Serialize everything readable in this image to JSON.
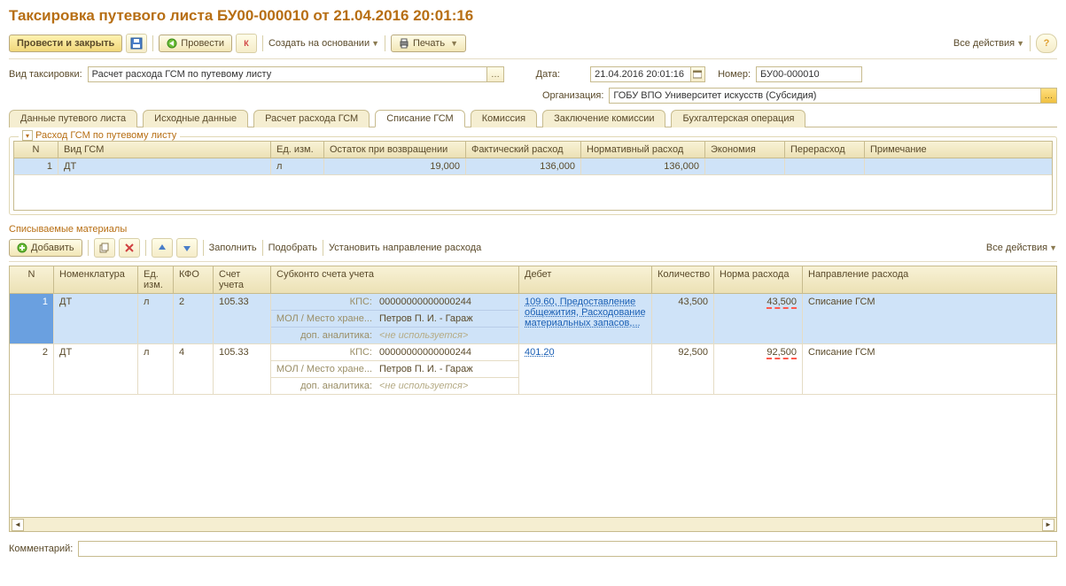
{
  "header": {
    "title": "Таксировка путевого листа БУ00-000010 от 21.04.2016 20:01:16"
  },
  "toolbar": {
    "post_close": "Провести и закрыть",
    "post": "Провести",
    "create_based": "Создать на основании",
    "print": "Печать",
    "all_actions": "Все действия"
  },
  "form": {
    "type_label": "Вид таксировки:",
    "type_value": "Расчет расхода ГСМ по путевому листу",
    "date_label": "Дата:",
    "date_value": "21.04.2016 20:01:16",
    "number_label": "Номер:",
    "number_value": "БУ00-000010",
    "org_label": "Организация:",
    "org_value": "ГОБУ ВПО Университет искусств (Субсидия)"
  },
  "tabs": [
    "Данные путевого листа",
    "Исходные данные",
    "Расчет расхода ГСМ",
    "Списание ГСМ",
    "Комиссия",
    "Заключение комиссии",
    "Бухгалтерская операция"
  ],
  "active_tab": 3,
  "fuel_group": {
    "legend": "Расход ГСМ по путевому листу",
    "headers": [
      "N",
      "Вид ГСМ",
      "Ед. изм.",
      "Остаток при возвращении",
      "Фактический расход",
      "Нормативный расход",
      "Экономия",
      "Перерасход",
      "Примечание"
    ],
    "widths": [
      50,
      240,
      60,
      160,
      130,
      140,
      90,
      90,
      200
    ],
    "rows": [
      {
        "n": "1",
        "kind": "ДТ",
        "unit": "л",
        "remain": "19,000",
        "fact": "136,000",
        "norm": "136,000",
        "econ": "",
        "over": "",
        "note": ""
      }
    ]
  },
  "materials": {
    "title": "Списываемые материалы",
    "add": "Добавить",
    "fill": "Заполнить",
    "pick": "Подобрать",
    "set_dir": "Установить направление расхода",
    "all_actions": "Все действия",
    "headers": [
      "N",
      "Номенклатура",
      "Ед. изм.",
      "КФО",
      "Счет учета",
      "Субконто счета учета",
      "Дебет",
      "Количество",
      "Норма расхода",
      "Направление расхода"
    ],
    "widths": [
      50,
      95,
      40,
      45,
      65,
      280,
      150,
      70,
      100,
      245
    ],
    "sub_labels": {
      "kps": "КПС:",
      "mol": "МОЛ / Место хране...",
      "add": "доп. аналитика:",
      "not_used": "<не используется>"
    },
    "rows": [
      {
        "n": "1",
        "nom": "ДТ",
        "unit": "л",
        "kfo": "2",
        "acc": "105.33",
        "kps": "00000000000000244",
        "mol": "Петров П. И. - Гараж",
        "debit": "109.60, Предоставление общежития, Расходование материальных запасов,...",
        "qty": "43,500",
        "norm": "43,500",
        "dir": "Списание ГСМ"
      },
      {
        "n": "2",
        "nom": "ДТ",
        "unit": "л",
        "kfo": "4",
        "acc": "105.33",
        "kps": "00000000000000244",
        "mol": "Петров П. И. - Гараж",
        "debit": "401.20",
        "qty": "92,500",
        "norm": "92,500",
        "dir": "Списание ГСМ"
      }
    ]
  },
  "comment_label": "Комментарий:"
}
